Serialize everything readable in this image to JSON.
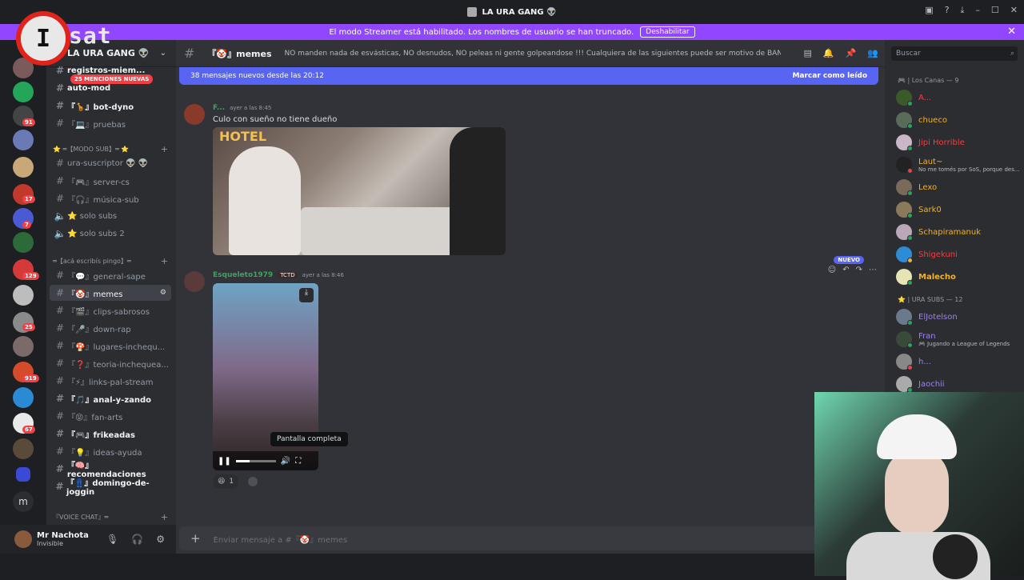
{
  "window": {
    "title": "LA URA GANG 👽",
    "controls": [
      "▣",
      "?",
      "⤓",
      "–",
      "☐",
      "✕"
    ]
  },
  "banner": {
    "text": "El modo Streamer está habilitado. Los nombres de usuario se han truncado.",
    "button": "Deshabilitar",
    "close": "✕"
  },
  "overlay_logo": {
    "letter": "I",
    "suffix": "sat"
  },
  "guilds": {
    "badges": [
      "91",
      "17",
      "7",
      "129",
      "25",
      "919",
      "67"
    ],
    "letter_m": "m"
  },
  "server": {
    "name": "LA URA GANG 👽",
    "mentions_pill": "25 MENCIONES NUEVAS",
    "channels": [
      {
        "label": "registros-miem...",
        "unread": true
      },
      {
        "label": "auto-mod",
        "unread": true
      },
      {
        "label": "『🦒』bot-dyno",
        "unread": true
      },
      {
        "label": "『💻』pruebas",
        "unread": false
      },
      {
        "label": "ura-suscriptor 👽 👽",
        "unread": false
      },
      {
        "label": "『🎮』server-cs",
        "unread": false
      },
      {
        "label": "『🎧』música-sub",
        "unread": false
      },
      {
        "label": "⭐ solo subs",
        "unread": false,
        "voice": true
      },
      {
        "label": "⭐ solo subs 2",
        "unread": false,
        "voice": true
      },
      {
        "label": "『💬』general-sape",
        "unread": false
      },
      {
        "label": "『🤡』memes",
        "unread": false,
        "active": true
      },
      {
        "label": "『🎬』clips-sabrosos",
        "unread": false
      },
      {
        "label": "『🎤』down-rap",
        "unread": false
      },
      {
        "label": "『🍄』lugares-inchequ...",
        "unread": false
      },
      {
        "label": "『❓』teoria-inchequea...",
        "unread": false
      },
      {
        "label": "『⚡』links-pal-stream",
        "unread": false
      },
      {
        "label": "『🎵』anal-y-zando",
        "unread": true
      },
      {
        "label": "『😝』fan-arts",
        "unread": false
      },
      {
        "label": "『🎮』frikeadas",
        "unread": true
      },
      {
        "label": "『💡』ideas-ayuda",
        "unread": false
      },
      {
        "label": "『🧠』recomendaciones",
        "unread": true
      },
      {
        "label": "『👖』domingo-de-joggin",
        "unread": true
      }
    ],
    "categories": [
      "⭐ ═【MODO SUB】═ ⭐",
      "═【acá escribís pingo】═",
      "『VOICE CHAT』═"
    ]
  },
  "user": {
    "name": "Mr Nachota",
    "status": "Invisible"
  },
  "channel": {
    "name": "『🤡』memes",
    "topic": "NO manden nada de esvásticas, NO desnudos, NO peleas ni gente golpeandose !!! Cualquiera de las siguientes puede ser motivo de BAN, cuiden el stream!",
    "new_messages": "38 mensajes nuevos desde las 20:12",
    "mark_read": "Marcar como leído"
  },
  "messages": [
    {
      "author": "F...",
      "time": "ayer a las 8:45",
      "text": "Culo con sueño no tiene dueño",
      "image_overlay": "HOTEL"
    },
    {
      "author": "Esqueleto1979",
      "tag": "TCTD",
      "time": "ayer a las 8:46",
      "tooltip": "Pantalla completa",
      "reaction_count": "1",
      "new_label": "NUEVO",
      "video_progress": 0.35
    }
  ],
  "composer": {
    "placeholder": "Enviar mensaje a #『🤡』memes"
  },
  "members": {
    "search_placeholder": "Buscar",
    "groups": [
      {
        "title": "🎮 | Los Canas — 9",
        "items": [
          {
            "name": "A...",
            "color": "#f23f43",
            "avatar": "#3b5a2a",
            "status": "#23a55a"
          },
          {
            "name": "chueco",
            "color": "#f0b232",
            "avatar": "#5b6b5a",
            "status": "#23a55a"
          },
          {
            "name": "Jipi Horrible",
            "color": "#f23f43",
            "avatar": "#c9b7c7",
            "status": "#23a55a"
          },
          {
            "name": "Laut~",
            "color": "#f0b232",
            "avatar": "#222",
            "status": "#f23f43",
            "sub": "No me tomés por SoS, porque des..."
          },
          {
            "name": "Lexo",
            "color": "#f0b232",
            "avatar": "#7a6a5a",
            "status": "#23a55a"
          },
          {
            "name": "Sark0",
            "color": "#f0b232",
            "avatar": "#8a7a5a",
            "status": "#23a55a"
          },
          {
            "name": "Schapiramanuk",
            "color": "#f0b232",
            "avatar": "#b8a8b8",
            "status": "#23a55a"
          },
          {
            "name": "Shigekuni",
            "color": "#f23f43",
            "avatar": "#2e8bd6",
            "status": "#f0b232"
          },
          {
            "name": "Malecho",
            "color": "#f0b232",
            "avatar": "#e7e4b4",
            "status": "#23a55a",
            "bold": true
          }
        ]
      },
      {
        "title": "⭐ | URA SUBS — 12",
        "items": [
          {
            "name": "ElJotelson",
            "color": "#9b84ec",
            "avatar": "#6a7a8a",
            "status": "#23a55a"
          },
          {
            "name": "Fran",
            "color": "#9b84ec",
            "avatar": "#3a4a3a",
            "status": "#23a55a",
            "sub": "🎮 Jugando a League of Legends"
          },
          {
            "name": "h...",
            "color": "#9b84ec",
            "avatar": "#888",
            "status": "#f23f43"
          },
          {
            "name": "Jaochii",
            "color": "#9b84ec",
            "avatar": "#aaa",
            "status": "#23a55a"
          }
        ]
      }
    ]
  },
  "colors": {
    "accent": "#5865f2",
    "streamer_banner": "#9146ff",
    "green_author": "#3ba55d"
  }
}
